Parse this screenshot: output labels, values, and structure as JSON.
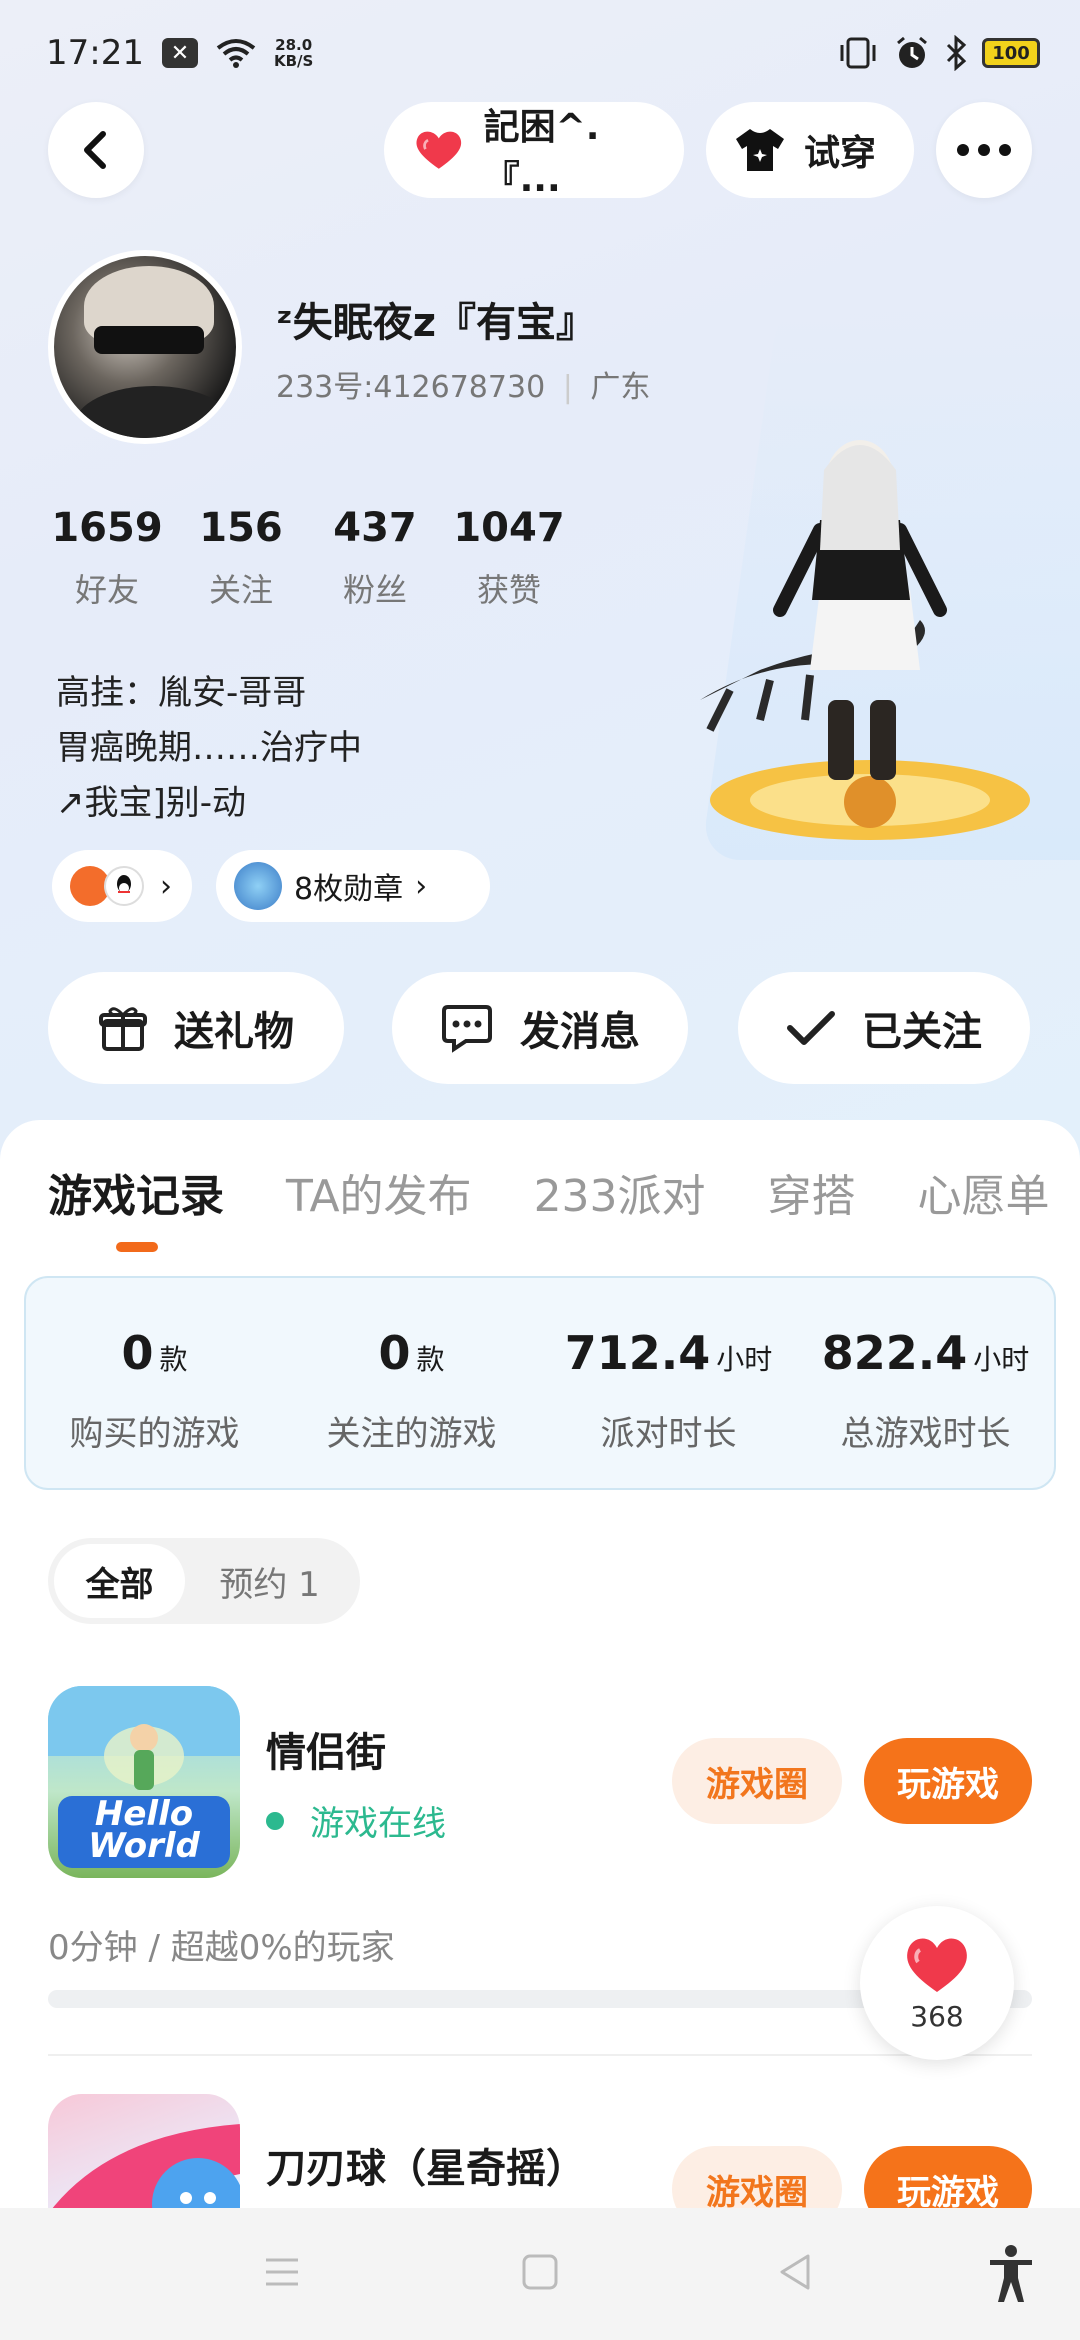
{
  "status_bar": {
    "time": "17:21",
    "net_speed_value": "28.0",
    "net_speed_unit": "KB/S",
    "battery": "100"
  },
  "top_nav": {
    "friend_pill_label": "記困^.『...",
    "try_on_label": "试穿"
  },
  "profile": {
    "name": "ᶻ失眠夜z『有宝』",
    "id_line": "233号:412678730",
    "region": "广东",
    "stats": [
      {
        "value": "1659",
        "label": "好友"
      },
      {
        "value": "156",
        "label": "关注"
      },
      {
        "value": "437",
        "label": "粉丝"
      },
      {
        "value": "1047",
        "label": "获赞"
      }
    ],
    "bio_lines": [
      "高挂：胤安-哥哥",
      "胃癌晚期……治疗中",
      "↗我宝]别-动"
    ],
    "medals_label": "8枚勋章"
  },
  "actions": {
    "gift_label": "送礼物",
    "message_label": "发消息",
    "followed_label": "已关注"
  },
  "tabs": [
    {
      "label": "游戏记录",
      "active": true
    },
    {
      "label": "TA的发布",
      "active": false
    },
    {
      "label": "233派对",
      "active": false
    },
    {
      "label": "穿搭",
      "active": false
    },
    {
      "label": "心愿单",
      "active": false
    }
  ],
  "summary": [
    {
      "value": "0",
      "unit": "款",
      "label": "购买的游戏"
    },
    {
      "value": "0",
      "unit": "款",
      "label": "关注的游戏"
    },
    {
      "value": "712.4",
      "unit": "小时",
      "label": "派对时长"
    },
    {
      "value": "822.4",
      "unit": "小时",
      "label": "总游戏时长"
    }
  ],
  "filter": {
    "all_label": "全部",
    "reserve_label": "预约 1"
  },
  "games": [
    {
      "title": "情侣街",
      "status": "游戏在线",
      "circle_label": "游戏圈",
      "play_label": "玩游戏",
      "playtime": "0分钟 / 超越0%的玩家",
      "progress": 0,
      "icon_text_1": "Hello",
      "icon_text_2": "World"
    },
    {
      "title": "刀刃球（星奇摇）",
      "circle_label": "游戏圈",
      "play_label": "玩游戏"
    }
  ],
  "like": {
    "count": "368"
  },
  "colors": {
    "accent_orange": "#f5731a",
    "online_green": "#2cb98f",
    "heart_red": "#f0394b"
  }
}
